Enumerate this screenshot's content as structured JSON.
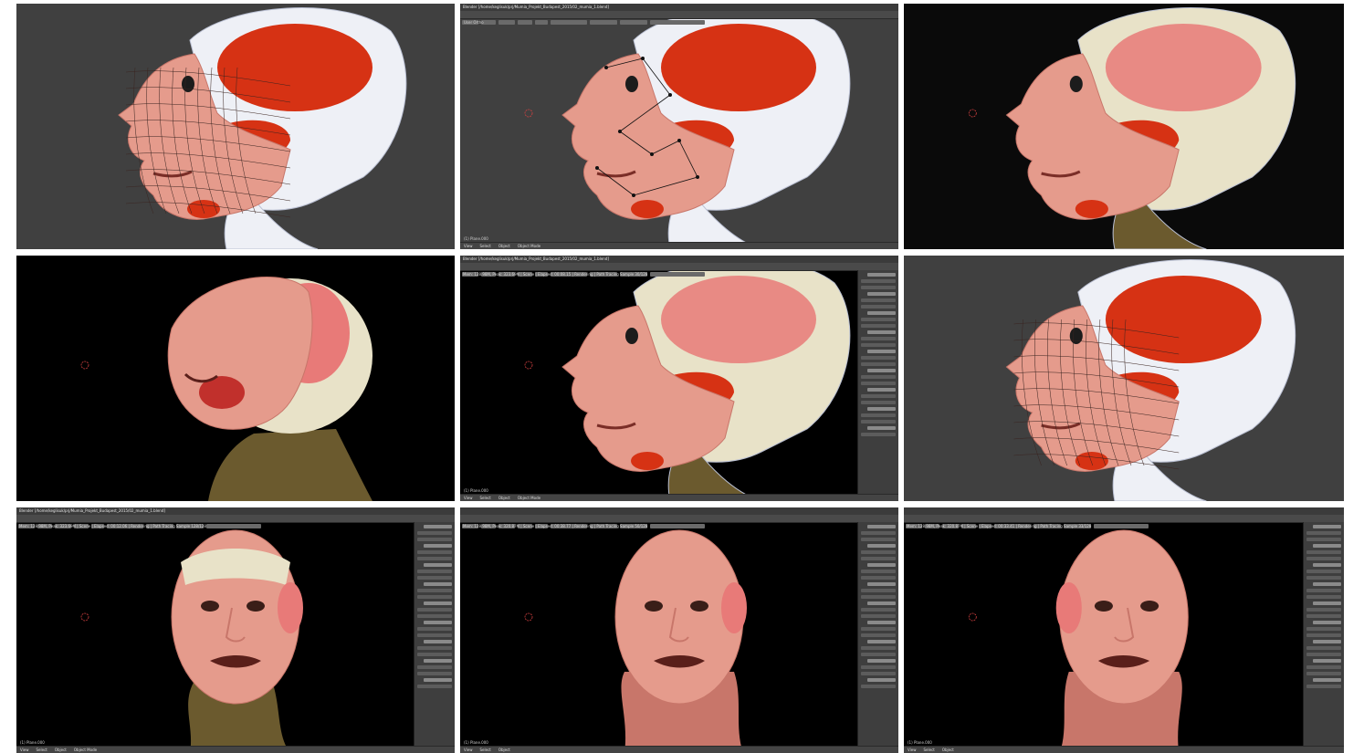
{
  "panels": [
    {
      "id": "p1",
      "theme": "grey",
      "view": "left",
      "mode": "wire"
    },
    {
      "id": "p2",
      "theme": "grey-ui",
      "view": "left",
      "mode": "rig",
      "title": "Blender [/home/keglisuk/prj/Mumia_Projekt_Budapest_2015/02_mumia_1.blend]",
      "viewport_label": "User Ortho",
      "object_label": "(1) Plane.000",
      "mode_label": "Object Mode"
    },
    {
      "id": "p3",
      "theme": "dark",
      "view": "left",
      "mode": "render"
    },
    {
      "id": "p4",
      "theme": "black",
      "view": "tilt",
      "mode": "render"
    },
    {
      "id": "p5",
      "theme": "black-ui",
      "view": "left3q",
      "mode": "render",
      "title": "Blender [/home/keglisuk/prj/Mumia_Projekt_Budapest_2015/02_mumia_1.blend]",
      "info_line": "Mem: 128.98M, Peak: 323.69M | Scene | Elapsed: 00:08.15 | Rendering | Path Tracing Sample 30/128",
      "object_label": "(1) Plane.000",
      "mode_label": "Object Mode",
      "render_engine": "Cycles Render"
    },
    {
      "id": "p6",
      "theme": "grey",
      "view": "left",
      "mode": "wire"
    },
    {
      "id": "p7",
      "theme": "black-ui",
      "view": "front",
      "mode": "render",
      "title": "Blender [/home/keglisuk/prj/Mumia_Projekt_Budapest_2015/02_mumia_1.blend]",
      "info_line": "Mem: 128.98M, Peak: 323.69M | Scene | Elapsed: 00:12.06 | Rendering | Path Tracing Sample 128/128",
      "object_label": "(1) Plane.000",
      "mode_label": "Object Mode",
      "render_engine": "Cycles Render"
    },
    {
      "id": "p8",
      "theme": "black-ui",
      "view": "front3q",
      "mode": "skin",
      "title": "",
      "info_line": "Mem: 128.98M, Peak: 320.87M | Scene | Elapsed: 00:38.77 | Rendering | Path Tracing Sample 50/128",
      "object_label": "(1) Plane.000",
      "mode_label": "",
      "render_engine": "Cycles Render"
    },
    {
      "id": "p9",
      "theme": "black-ui",
      "view": "right3q",
      "mode": "skin",
      "title": "",
      "info_line": "Mem: 128.98M, Peak: 320.87M | Scene | Elapsed: 00:33.41 | Rendering | Path Tracing Sample 33/128",
      "object_label": "(1) Plane.000",
      "mode_label": "",
      "render_engine": "Cycles Render"
    }
  ],
  "colors": {
    "viewport_grey": "#404040",
    "viewport_dark": "#0a0a0a",
    "skin": "#e59b8c",
    "skin_dark": "#c8766a",
    "muscle": "#d63214",
    "bone": "#eef0f6",
    "bone_shadow": "#b9bfd2",
    "mummy": "#6b5a2e",
    "skull_ivory": "#e8e2c8"
  }
}
